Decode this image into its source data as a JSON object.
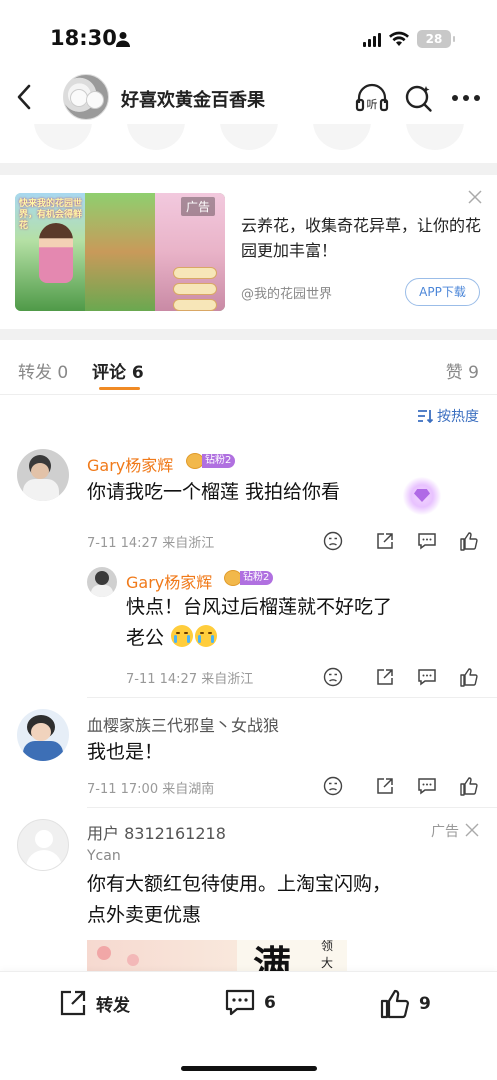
{
  "status": {
    "time": "18:30",
    "battery": "28"
  },
  "header": {
    "title": "好喜欢黄金百香果",
    "listen_label": "听"
  },
  "ad": {
    "tag": "广告",
    "text": "云养花，收集奇花异草，让你的花园更加丰富！",
    "source": "@我的花园世界",
    "button": "APP下载",
    "image_headline": "快来我的花园世界，有机会得鲜花"
  },
  "tabs": {
    "repost": "转发 0",
    "comment": "评论 6",
    "like": "赞 9"
  },
  "sort_label": "按热度",
  "comments": [
    {
      "name": "Gary杨家辉",
      "badge": "钻粉2",
      "text": "你请我吃一个榴莲 我拍给你看",
      "meta": "7-11 14:27  来自浙江",
      "reply": {
        "name": "Gary杨家辉",
        "badge": "钻粉2",
        "line1": "快点！台风过后榴莲就不好吃了",
        "line2": "老公",
        "meta": "7-11 14:27  来自浙江"
      }
    },
    {
      "name": "血樱家族三代邪皇丶女战狼",
      "text": "我也是！",
      "meta": "7-11 17:00  来自湖南"
    },
    {
      "name": "用户 8312161218",
      "sub": "Ycan",
      "ad_label": "广告",
      "line1": "你有大额红包待使用。上淘宝闪购，",
      "line2": "点外卖更优惠",
      "image_text": "满",
      "image_text2": "领",
      "image_text3": "大"
    }
  ],
  "bottom": {
    "repost": "转发",
    "comment": "6",
    "like": "9"
  },
  "colors": {
    "accent": "#f08a24",
    "link": "#3b6fc0",
    "name": "#f07a1a"
  }
}
